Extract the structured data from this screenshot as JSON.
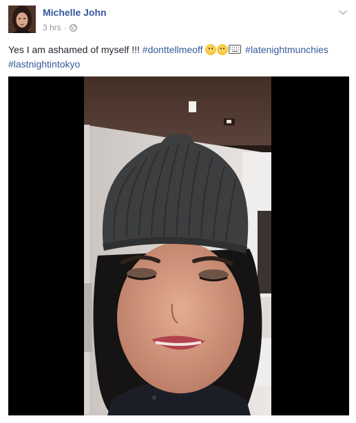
{
  "post": {
    "author": "Michelle John",
    "time": "3 hrs",
    "separator": "·",
    "privacy_icon": "globe-icon",
    "menu_icon": "chevron-down-icon",
    "text_plain": "Yes I am ashamed of myself !!! ",
    "hashtags": [
      "#donttellmeoff",
      "#latenightmunchies",
      "#lastnightintokyo"
    ],
    "emojis": [
      "grinning-face-icon",
      "smiling-face-icon",
      "keyboard-icon"
    ]
  },
  "colors": {
    "link": "#365899",
    "meta": "#90949c",
    "text": "#1d2129",
    "video_bg": "#000000"
  }
}
